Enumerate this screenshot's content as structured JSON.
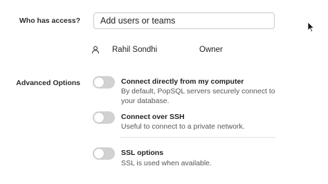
{
  "access": {
    "label": "Who has access?",
    "input_value": "Add users or teams"
  },
  "members": [
    {
      "name": "Rahil Sondhi",
      "role": "Owner"
    }
  ],
  "advanced": {
    "label": "Advanced Options",
    "options": [
      {
        "title": "Connect directly from my computer",
        "description": "By default, PopSQL servers securely connect to your database.",
        "enabled": false
      },
      {
        "title": "Connect over SSH",
        "description": "Useful to connect to a private network.",
        "enabled": false
      },
      {
        "title": "SSL options",
        "description": "SSL is used when available.",
        "enabled": false
      }
    ]
  },
  "colors": {
    "toggle_off": "#d1d1d1",
    "border": "#c9c9c9"
  }
}
